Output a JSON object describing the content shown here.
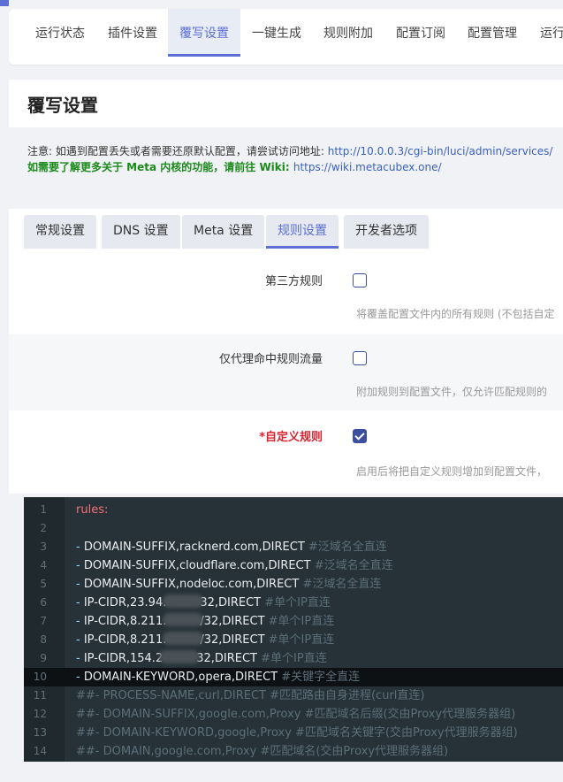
{
  "topnav": {
    "items": [
      "运行状态",
      "插件设置",
      "覆写设置",
      "一键生成",
      "规则附加",
      "配置订阅",
      "配置管理",
      "运行"
    ],
    "active_index": 2
  },
  "page": {
    "title": "覆写设置",
    "note_prefix": "注意: 如遇到配置丢失或者需要还原默认配置，请尝试访问地址: ",
    "note_url": "http://10.0.0.3/cgi-bin/luci/admin/services/",
    "meta_prefix": "如需要了解更多关于 Meta 内核的功能，请前往 Wiki: ",
    "meta_url": "https://wiki.metacubex.one/"
  },
  "subtabs": {
    "items": [
      "常规设置",
      "DNS 设置",
      "Meta 设置",
      "规则设置",
      "开发者选项"
    ],
    "active_index": 3
  },
  "form": {
    "rows": [
      {
        "label": "第三方规则",
        "required": false,
        "checked": false,
        "desc": "将覆盖配置文件内的所有规则 (不包括自定"
      },
      {
        "label": "仅代理命中规则流量",
        "required": false,
        "checked": false,
        "desc": "附加规则到配置文件，仅允许匹配规则的"
      },
      {
        "label": "*自定义规则",
        "required": true,
        "checked": true,
        "desc": "启用后将把自定义规则增加到配置文件，"
      }
    ]
  },
  "editor": {
    "current_line": 10,
    "lines": [
      {
        "n": "1",
        "key": "rules:"
      },
      {
        "n": "2"
      },
      {
        "n": "3",
        "dash": "- ",
        "text": "DOMAIN-SUFFIX,racknerd.com,DIRECT ",
        "comment": "#泛域名全直连"
      },
      {
        "n": "4",
        "dash": "- ",
        "text": "DOMAIN-SUFFIX,cloudflare.com,DIRECT ",
        "comment": "#泛域名全直连"
      },
      {
        "n": "5",
        "dash": "- ",
        "text": "DOMAIN-SUFFIX,nodeloc.com,DIRECT ",
        "comment": "#泛域名全直连"
      },
      {
        "n": "6",
        "dash": "- ",
        "text": "IP-CIDR,23.94.",
        "redacted": true,
        "text2": "32,DIRECT ",
        "comment": "#单个IP直连"
      },
      {
        "n": "7",
        "dash": "- ",
        "text": "IP-CIDR,8.211.",
        "redacted": true,
        "text2": "/32,DIRECT ",
        "comment": "#单个IP直连"
      },
      {
        "n": "8",
        "dash": "- ",
        "text": "IP-CIDR,8.211.",
        "redacted": true,
        "text2": "/32,DIRECT ",
        "comment": "#单个IP直连"
      },
      {
        "n": "9",
        "dash": "- ",
        "text": "IP-CIDR,154.2",
        "redacted": true,
        "text2": "32,DIRECT ",
        "comment": "#单个IP直连"
      },
      {
        "n": "10",
        "dash": "- ",
        "text": "DOMAIN-KEYWORD,opera,DIRECT ",
        "comment": "#关键字全直连"
      },
      {
        "n": "11",
        "comment": "##- PROCESS-NAME,curl,DIRECT #匹配路由自身进程(curl直连)"
      },
      {
        "n": "12",
        "comment": "##- DOMAIN-SUFFIX,google.com,Proxy #匹配域名后缀(交由Proxy代理服务器组)"
      },
      {
        "n": "13",
        "comment": "##- DOMAIN-KEYWORD,google,Proxy #匹配域名关键字(交由Proxy代理服务器组)"
      },
      {
        "n": "14",
        "comment": "##- DOMAIN,google.com,Proxy #匹配域名(交由Proxy代理服务器组)"
      }
    ]
  },
  "colors": {
    "accent": "#5b6fd6",
    "required": "#d9232e",
    "wiki_note": "#1b8a1b",
    "editor_bg": "#263238"
  }
}
